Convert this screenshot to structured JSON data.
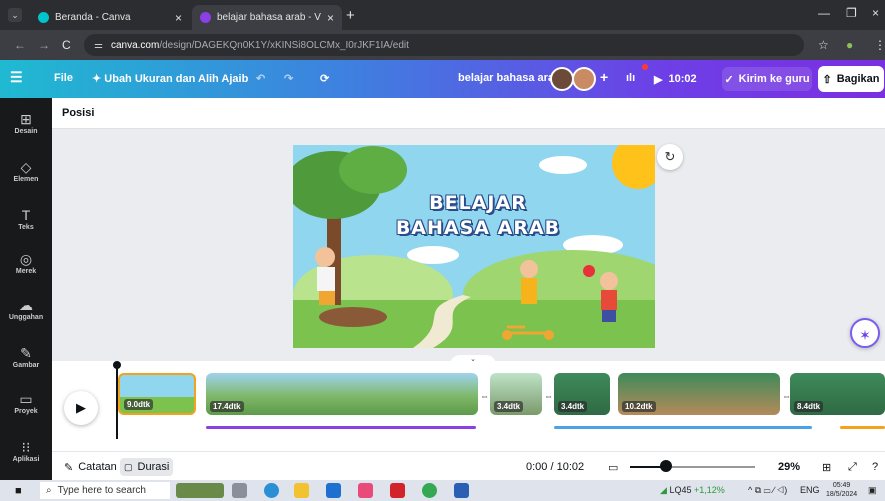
{
  "browser": {
    "tabs": [
      {
        "title": "Beranda - Canva",
        "active": false
      },
      {
        "title": "belajar bahasa arab - Video",
        "active": true
      }
    ],
    "url_domain": "canva.com",
    "url_path": "/design/DAGEKQn0K1Y/xKINSi8OLCMx_I0rJKF1IA/edit"
  },
  "toolbar": {
    "menu_icon": "hamburger-icon",
    "file_label": "File",
    "resize_label": "Ubah Ukuran dan Alih Ajaib",
    "title": "belajar bahasa arab",
    "add_label": "+",
    "timer": "10:02",
    "send_label": "Kirim ke guru",
    "share_label": "Bagikan"
  },
  "sidebar": {
    "items": [
      {
        "label": "Desain",
        "icon": "layout-icon"
      },
      {
        "label": "Elemen",
        "icon": "shapes-icon"
      },
      {
        "label": "Teks",
        "icon": "text-icon"
      },
      {
        "label": "Merek",
        "icon": "brand-icon"
      },
      {
        "label": "Unggahan",
        "icon": "upload-icon"
      },
      {
        "label": "Gambar",
        "icon": "draw-icon"
      },
      {
        "label": "Proyek",
        "icon": "folder-icon"
      },
      {
        "label": "Aplikasi",
        "icon": "apps-icon"
      }
    ]
  },
  "context": {
    "position_label": "Posisi"
  },
  "design": {
    "title_line1": "BELAJAR",
    "title_line2": "BAHASA ARAB"
  },
  "timeline": {
    "clips": [
      {
        "duration": "9.0dtk"
      },
      {
        "duration": "17.4dtk"
      },
      {
        "duration": "3.4dtk"
      },
      {
        "duration": "3.4dtk"
      },
      {
        "duration": "10.2dtk"
      },
      {
        "duration": "8.4dtk"
      }
    ]
  },
  "status": {
    "notes_label": "Catatan",
    "duration_label": "Durasi",
    "time": "0:00 / 10:02",
    "zoom": "29%",
    "zoom_fraction": 0.29
  },
  "taskbar": {
    "search_placeholder": "Type here to search",
    "stock": "LQ45",
    "stock_change": "+1,12%",
    "lang": "ENG",
    "clock_time": "05:49",
    "clock_date": "18/5/2024"
  },
  "colors": {
    "toolbar_start": "#1fbad1",
    "toolbar_end": "#7a2fe0",
    "selected_clip_border": "#f4a11c",
    "audio_purple": "#8b3fe6",
    "audio_blue": "#4aa3e8",
    "audio_orange": "#f4a11c"
  }
}
